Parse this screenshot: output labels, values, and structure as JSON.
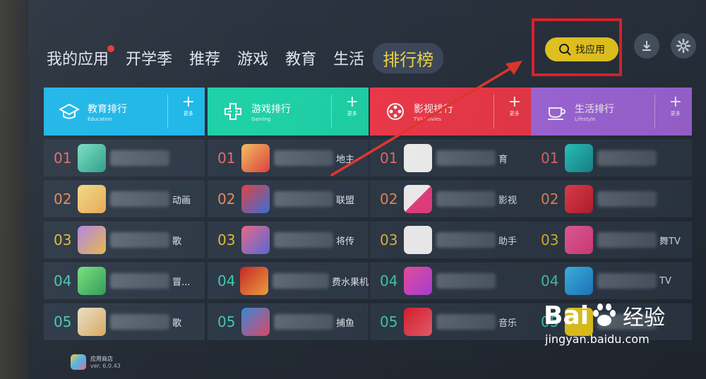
{
  "nav": {
    "items": [
      "我的应用",
      "开学季",
      "推荐",
      "游戏",
      "教育",
      "生活"
    ],
    "active": "排行榜"
  },
  "toolbar": {
    "find_label": "找应用"
  },
  "columns": [
    {
      "title": "教育排行",
      "subtitle": "Education",
      "more": "更多",
      "color": "#20b7e8",
      "rows": [
        {
          "rank": "01",
          "name": ""
        },
        {
          "rank": "02",
          "name": "动画"
        },
        {
          "rank": "03",
          "name": "歌"
        },
        {
          "rank": "04",
          "name": "冒..."
        },
        {
          "rank": "05",
          "name": "歌"
        }
      ]
    },
    {
      "title": "游戏排行",
      "subtitle": "Gaming",
      "more": "更多",
      "color": "#1fd1a7",
      "rows": [
        {
          "rank": "01",
          "name": "地主"
        },
        {
          "rank": "02",
          "name": "联盟"
        },
        {
          "rank": "03",
          "name": "将传"
        },
        {
          "rank": "04",
          "name": "费水果机"
        },
        {
          "rank": "05",
          "name": "捕鱼"
        }
      ]
    },
    {
      "title": "影视排行",
      "subtitle": "TV&Movies",
      "more": "更多",
      "color": "#f03a4b",
      "rows": [
        {
          "rank": "01",
          "name": "育"
        },
        {
          "rank": "02",
          "name": "影视"
        },
        {
          "rank": "03",
          "name": "助手"
        },
        {
          "rank": "04",
          "name": ""
        },
        {
          "rank": "05",
          "name": "音乐"
        }
      ]
    },
    {
      "title": "生活排行",
      "subtitle": "Lifestyle",
      "more": "更多",
      "color": "#a56ae0",
      "rows": [
        {
          "rank": "01",
          "name": ""
        },
        {
          "rank": "02",
          "name": ""
        },
        {
          "rank": "03",
          "name": "舞TV"
        },
        {
          "rank": "04",
          "name": "TV"
        },
        {
          "rank": "05",
          "name": ""
        }
      ]
    }
  ],
  "store": {
    "name": "应用商店",
    "version": "ver. 6.0.43"
  },
  "watermark": {
    "brand_left": "Bai",
    "brand_right": "经验",
    "url": "jingyan.baidu.com"
  },
  "colors": {
    "accent": "#f0cf22",
    "highlight_box": "#e8242c",
    "arrow": "#e83a30"
  }
}
